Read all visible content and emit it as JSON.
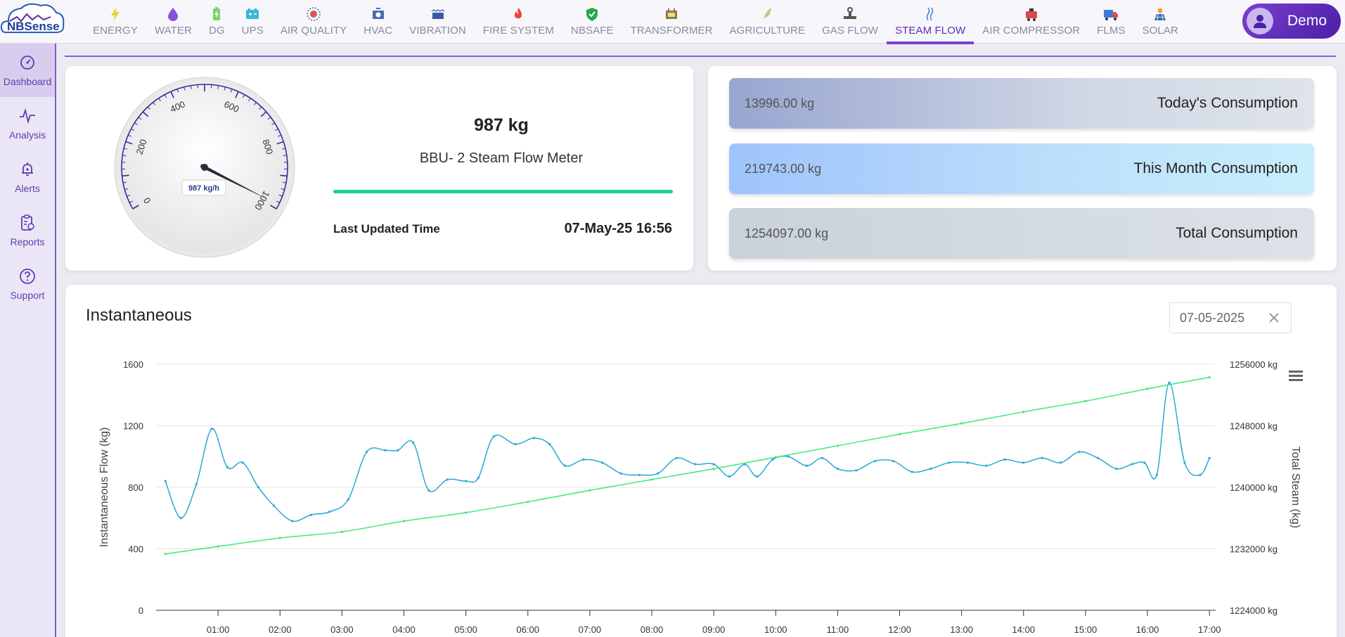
{
  "app": {
    "logo_text": "NBSense"
  },
  "nav": [
    {
      "label": "ENERGY",
      "icon": "bolt-icon",
      "color": "#e8d23a"
    },
    {
      "label": "WATER",
      "icon": "water-drop-icon",
      "color": "#8a4fd8"
    },
    {
      "label": "DG",
      "icon": "battery-icon",
      "color": "#7dd36a"
    },
    {
      "label": "UPS",
      "icon": "ups-battery-icon",
      "color": "#36b8d8"
    },
    {
      "label": "AIR QUALITY",
      "icon": "air-quality-icon",
      "color": "#d8564f"
    },
    {
      "label": "HVAC",
      "icon": "hvac-icon",
      "color": "#4a6ab8"
    },
    {
      "label": "VIBRATION",
      "icon": "vibration-icon",
      "color": "#3a5aa8"
    },
    {
      "label": "FIRE SYSTEM",
      "icon": "fire-icon",
      "color": "#e84a3a"
    },
    {
      "label": "NBSAFE",
      "icon": "shield-icon",
      "color": "#2aa84a"
    },
    {
      "label": "TRANSFORMER",
      "icon": "transformer-icon",
      "color": "#8a7a4a"
    },
    {
      "label": "AGRICULTURE",
      "icon": "leaf-icon",
      "color": "#b8c88a"
    },
    {
      "label": "GAS FLOW",
      "icon": "gas-valve-icon",
      "color": "#555555"
    },
    {
      "label": "STEAM FLOW",
      "icon": "steam-icon",
      "color": "#3a8ad8",
      "active": true
    },
    {
      "label": "AIR COMPRESSOR",
      "icon": "compressor-icon",
      "color": "#d84a4a"
    },
    {
      "label": "FLMS",
      "icon": "truck-icon",
      "color": "#3a7ad8"
    },
    {
      "label": "SOLAR",
      "icon": "solar-panel-icon",
      "color": "#e8a83a"
    }
  ],
  "user": {
    "name": "Demo"
  },
  "sidebar": [
    {
      "label": "Dashboard",
      "icon": "dashboard-icon",
      "active": true
    },
    {
      "label": "Analysis",
      "icon": "analysis-icon"
    },
    {
      "label": "Alerts",
      "icon": "alerts-bell-icon"
    },
    {
      "label": "Reports",
      "icon": "reports-clipboard-icon"
    },
    {
      "label": "Support",
      "icon": "support-question-icon"
    }
  ],
  "meter": {
    "value": "987 kg",
    "name": "BBU- 2 Steam Flow Meter",
    "gauge_value": 987,
    "gauge_readout": "987 kg/h",
    "gauge_ticks": [
      "0",
      "200",
      "400",
      "600",
      "800",
      "1000"
    ],
    "gauge_max": 1000,
    "progress": 1.0,
    "last_updated_label": "Last Updated Time",
    "last_updated_value": "07-May-25 16:56"
  },
  "consumption": [
    {
      "value": "13996.00 kg",
      "label": "Today's Consumption"
    },
    {
      "value": "219743.00 kg",
      "label": "This Month Consumption"
    },
    {
      "value": "1254097.00 kg",
      "label": "Total Consumption"
    }
  ],
  "chart": {
    "title": "Instantaneous",
    "date": "07-05-2025"
  },
  "chart_data": {
    "type": "line",
    "xlabel": "",
    "ylabel": "Instantaneous Flow (kg)",
    "y2label": "Total Steam (kg)",
    "x_ticks": [
      "01:00",
      "02:00",
      "03:00",
      "04:00",
      "05:00",
      "06:00",
      "07:00",
      "08:00",
      "09:00",
      "10:00",
      "11:00",
      "12:00",
      "13:00",
      "14:00",
      "15:00",
      "16:00",
      "17:00"
    ],
    "y_ticks": [
      "0",
      "400",
      "800",
      "1200",
      "1600"
    ],
    "y2_ticks": [
      "1224000 kg",
      "1232000 kg",
      "1240000 kg",
      "1248000 kg",
      "1256000 kg"
    ],
    "ylim": [
      0,
      1600
    ],
    "y2lim": [
      1224000,
      1256000
    ],
    "xlim": [
      0,
      17.1
    ],
    "grid": true,
    "series": [
      {
        "axis": "left",
        "color": "#2aa7d6",
        "x": [
          0.15,
          0.4,
          0.65,
          0.9,
          1.15,
          1.4,
          1.65,
          1.9,
          2.2,
          2.5,
          2.8,
          3.1,
          3.4,
          3.7,
          3.9,
          4.15,
          4.4,
          4.7,
          5.0,
          5.2,
          5.45,
          5.8,
          6.1,
          6.35,
          6.6,
          6.9,
          7.2,
          7.5,
          7.8,
          8.1,
          8.4,
          8.7,
          9.0,
          9.25,
          9.5,
          9.7,
          9.95,
          10.2,
          10.5,
          10.75,
          11.0,
          11.3,
          11.6,
          11.9,
          12.2,
          12.5,
          12.8,
          13.1,
          13.4,
          13.7,
          14.0,
          14.3,
          14.6,
          14.9,
          15.2,
          15.5,
          15.75,
          15.95,
          16.15,
          16.35,
          16.6,
          16.85,
          17.0
        ],
        "y": [
          840,
          600,
          820,
          1180,
          930,
          960,
          800,
          680,
          580,
          620,
          640,
          720,
          1030,
          1040,
          1040,
          1090,
          780,
          850,
          840,
          860,
          1130,
          1080,
          1120,
          1080,
          940,
          980,
          960,
          890,
          880,
          890,
          990,
          950,
          950,
          870,
          950,
          870,
          980,
          1000,
          940,
          990,
          920,
          910,
          970,
          970,
          900,
          920,
          960,
          960,
          940,
          980,
          960,
          990,
          960,
          1030,
          990,
          920,
          950,
          960,
          880,
          1480,
          960,
          880,
          990
        ]
      },
      {
        "axis": "right",
        "color": "#3de87a",
        "x": [
          0.15,
          1.0,
          2.0,
          3.0,
          4.0,
          5.0,
          6.0,
          7.0,
          8.0,
          9.0,
          10.0,
          11.0,
          12.0,
          13.0,
          14.0,
          15.0,
          16.0,
          17.0
        ],
        "y": [
          1231330,
          1232300,
          1233400,
          1234200,
          1235600,
          1236700,
          1238100,
          1239600,
          1241000,
          1242400,
          1243900,
          1245400,
          1246900,
          1248300,
          1249800,
          1251200,
          1252800,
          1254300
        ]
      }
    ]
  }
}
